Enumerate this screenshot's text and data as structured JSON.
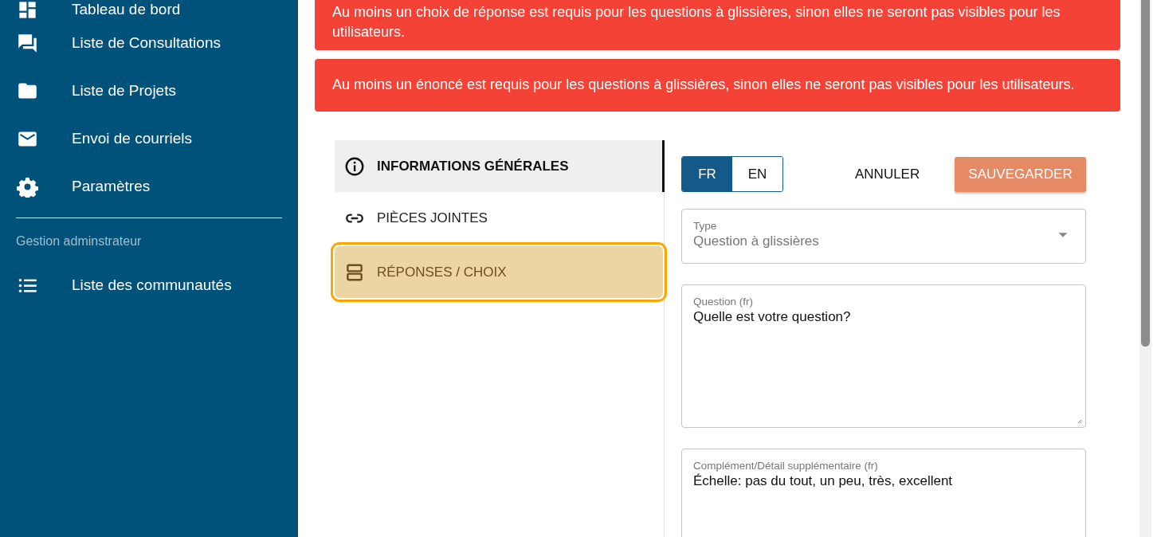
{
  "sidebar": {
    "items": [
      {
        "label": "Tableau de bord"
      },
      {
        "label": "Liste de Consultations"
      },
      {
        "label": "Liste de Projets"
      },
      {
        "label": "Envoi de courriels"
      },
      {
        "label": "Paramètres"
      }
    ],
    "section_label": "Gestion adminstrateur",
    "admin_items": [
      {
        "label": "Liste des communautés"
      }
    ]
  },
  "alerts": [
    {
      "text": "Au moins un choix de réponse est requis pour les questions à glissières, sinon elles ne seront pas visibles pour les utilisateurs."
    },
    {
      "text": "Au moins un énoncé est requis pour les questions à glissières, sinon elles ne seront pas visibles pour les utilisateurs."
    }
  ],
  "tabs": [
    {
      "label": "INFORMATIONS GÉNÉRALES",
      "selected": true,
      "highlighted": false
    },
    {
      "label": "PIÈCES JOINTES",
      "selected": false,
      "highlighted": false
    },
    {
      "label": "RÉPONSES / CHOIX",
      "selected": false,
      "highlighted": true
    }
  ],
  "language_toggle": [
    {
      "label": "FR",
      "selected": true
    },
    {
      "label": "EN",
      "selected": false
    }
  ],
  "cancel_button": "ANNULER",
  "save_button": "SAUVEGARDER",
  "fields": [
    {
      "kind": "select",
      "label": "Type",
      "value": "Question à glissières",
      "disabled": true
    },
    {
      "kind": "textarea",
      "label": "Question (fr)",
      "value": "Quelle est votre question?",
      "disabled": false
    },
    {
      "kind": "textarea",
      "label": "Complément/Détail supplémentaire (fr)",
      "value": "Échelle: pas du tout, un peu, très, excellent",
      "disabled": false
    }
  ]
}
